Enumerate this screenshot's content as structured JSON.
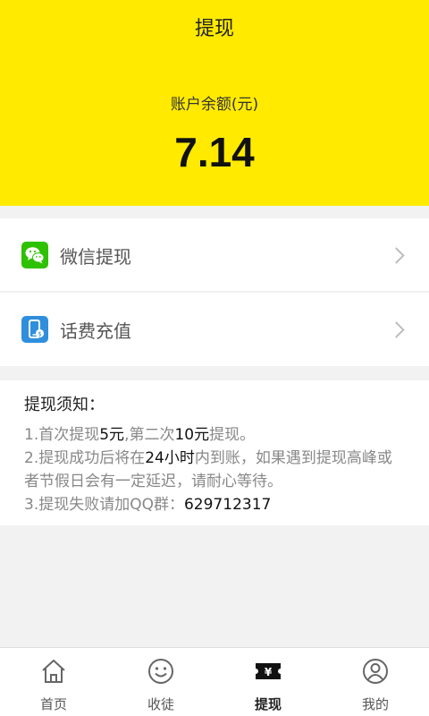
{
  "header": {
    "title": "提现",
    "balance_label": "账户余额(元)",
    "balance_value": "7.14",
    "bg_color": "#ffea00"
  },
  "menu": [
    {
      "label": "微信提现",
      "icon": "wechat-icon",
      "icon_color": "#2dc100"
    },
    {
      "label": "话费充值",
      "icon": "phone-recharge-icon",
      "icon_color": "#2f8fdd"
    }
  ],
  "notice": {
    "title": "提现须知：",
    "line1": {
      "a": "1.首次提现",
      "b": "5元",
      "c": ",第二次",
      "d": "10元",
      "e": "提现。"
    },
    "line2": {
      "a": "2.提现成功后将在",
      "b": "24小时",
      "c": "内到账，如果遇到提现高峰或者节假日会有一定延迟，请耐心等待。"
    },
    "line3": {
      "a": "3.提现失败请加QQ群：",
      "b": "629712317"
    }
  },
  "tabbar": {
    "items": [
      {
        "label": "首页",
        "icon": "home-icon"
      },
      {
        "label": "收徒",
        "icon": "smile-icon"
      },
      {
        "label": "提现",
        "icon": "ticket-yuan-icon",
        "active": true
      },
      {
        "label": "我的",
        "icon": "user-icon"
      }
    ]
  }
}
